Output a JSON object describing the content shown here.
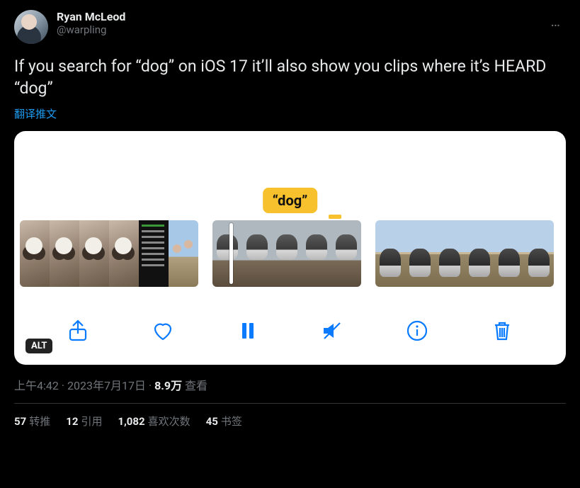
{
  "author": {
    "display_name": "Ryan McLeod",
    "handle": "@warpling"
  },
  "body": "If you search for “dog” on iOS 17 it’ll also show you clips where it’s HEARD “dog”",
  "translate_label": "翻译推文",
  "media": {
    "tooltip": "“dog”",
    "alt_badge": "ALT"
  },
  "meta": {
    "time": "上午4:42",
    "date": "2023年7月17日",
    "sep": " · ",
    "views_count": "8.9万",
    "views_label": " 查看"
  },
  "stats": {
    "retweets_count": "57",
    "retweets_label": "转推",
    "quotes_count": "12",
    "quotes_label": "引用",
    "likes_count": "1,082",
    "likes_label": "喜欢次数",
    "bookmarks_count": "45",
    "bookmarks_label": "书签"
  }
}
